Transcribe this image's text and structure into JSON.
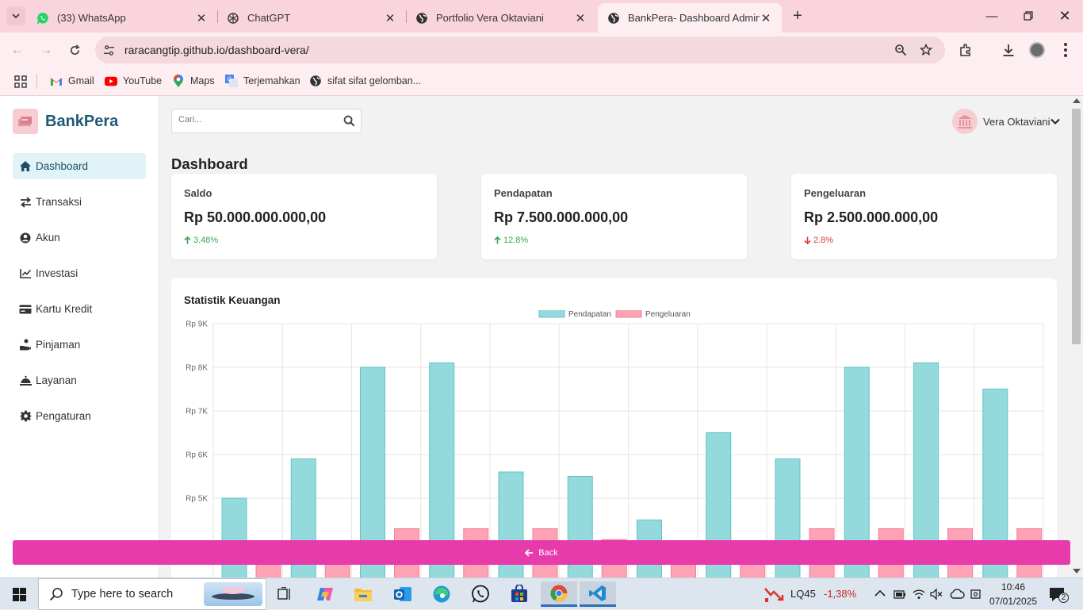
{
  "browser": {
    "tabs": [
      {
        "title": "(33) WhatsApp",
        "icon": "whatsapp-icon",
        "active": false
      },
      {
        "title": "ChatGPT",
        "icon": "chatgpt-icon",
        "active": false
      },
      {
        "title": "Portfolio Vera Oktaviani",
        "icon": "globe-icon",
        "active": false
      },
      {
        "title": "BankPera- Dashboard Admin Ba",
        "icon": "globe-icon",
        "active": true
      }
    ],
    "url": "raracangtip.github.io/dashboard-vera/",
    "bookmarks": [
      {
        "label": "Gmail",
        "icon": "gmail-icon"
      },
      {
        "label": "YouTube",
        "icon": "youtube-icon"
      },
      {
        "label": "Maps",
        "icon": "maps-icon"
      },
      {
        "label": "Terjemahkan",
        "icon": "translate-icon"
      },
      {
        "label": "sifat sifat gelomban...",
        "icon": "globe-icon"
      }
    ]
  },
  "app": {
    "brand": "BankPera",
    "search_placeholder": "Cari...",
    "user_name": "Vera Oktaviani",
    "page_title": "Dashboard",
    "sidebar": [
      {
        "label": "Dashboard",
        "icon": "home-icon",
        "active": true
      },
      {
        "label": "Transaksi",
        "icon": "exchange-icon",
        "active": false
      },
      {
        "label": "Akun",
        "icon": "user-icon",
        "active": false
      },
      {
        "label": "Investasi",
        "icon": "line-chart-icon",
        "active": false
      },
      {
        "label": "Kartu Kredit",
        "icon": "credit-card-icon",
        "active": false
      },
      {
        "label": "Pinjaman",
        "icon": "hand-coin-icon",
        "active": false
      },
      {
        "label": "Layanan",
        "icon": "service-bell-icon",
        "active": false
      },
      {
        "label": "Pengaturan",
        "icon": "gear-icon",
        "active": false
      }
    ],
    "cards": [
      {
        "label": "Saldo",
        "value": "Rp 50.000.000.000,00",
        "change": "3.48%",
        "direction": "up"
      },
      {
        "label": "Pendapatan",
        "value": "Rp 7.500.000.000,00",
        "change": "12.8%",
        "direction": "up"
      },
      {
        "label": "Pengeluaran",
        "value": "Rp 2.500.000.000,00",
        "change": "2.8%",
        "direction": "down"
      }
    ],
    "chart_title": "Statistik Keuangan",
    "back_label": "Back"
  },
  "colors": {
    "accent": "#e73aab",
    "brand": "#1f5a75",
    "up": "#3aa655",
    "down": "#e03c3c",
    "income_fill": "#94dadc",
    "expense_fill": "#fda3b5"
  },
  "chart_data": {
    "type": "bar",
    "title": "Statistik Keuangan",
    "legend": "top-center",
    "grid": true,
    "yticks": [
      "Rp 9K",
      "Rp 8K",
      "Rp 7K",
      "Rp 6K",
      "Rp 5K"
    ],
    "ylim_visible": [
      5000,
      9000
    ],
    "series": [
      {
        "name": "Pendapatan",
        "values": [
          5000,
          5900,
          8000,
          8100,
          5600,
          5500,
          4500,
          6500,
          5900,
          8000,
          8100,
          7500
        ]
      },
      {
        "name": "Pengeluaran",
        "values": [
          3500,
          3800,
          4300,
          4300,
          4300,
          4050,
          3500,
          3500,
          4300,
          4300,
          4300,
          4300
        ]
      }
    ]
  },
  "taskbar": {
    "search_placeholder": "Type here to search",
    "stock_ticker": "LQ45",
    "stock_change": "-1,38%",
    "time": "10:46",
    "date": "07/01/2025",
    "notifications": "2"
  }
}
